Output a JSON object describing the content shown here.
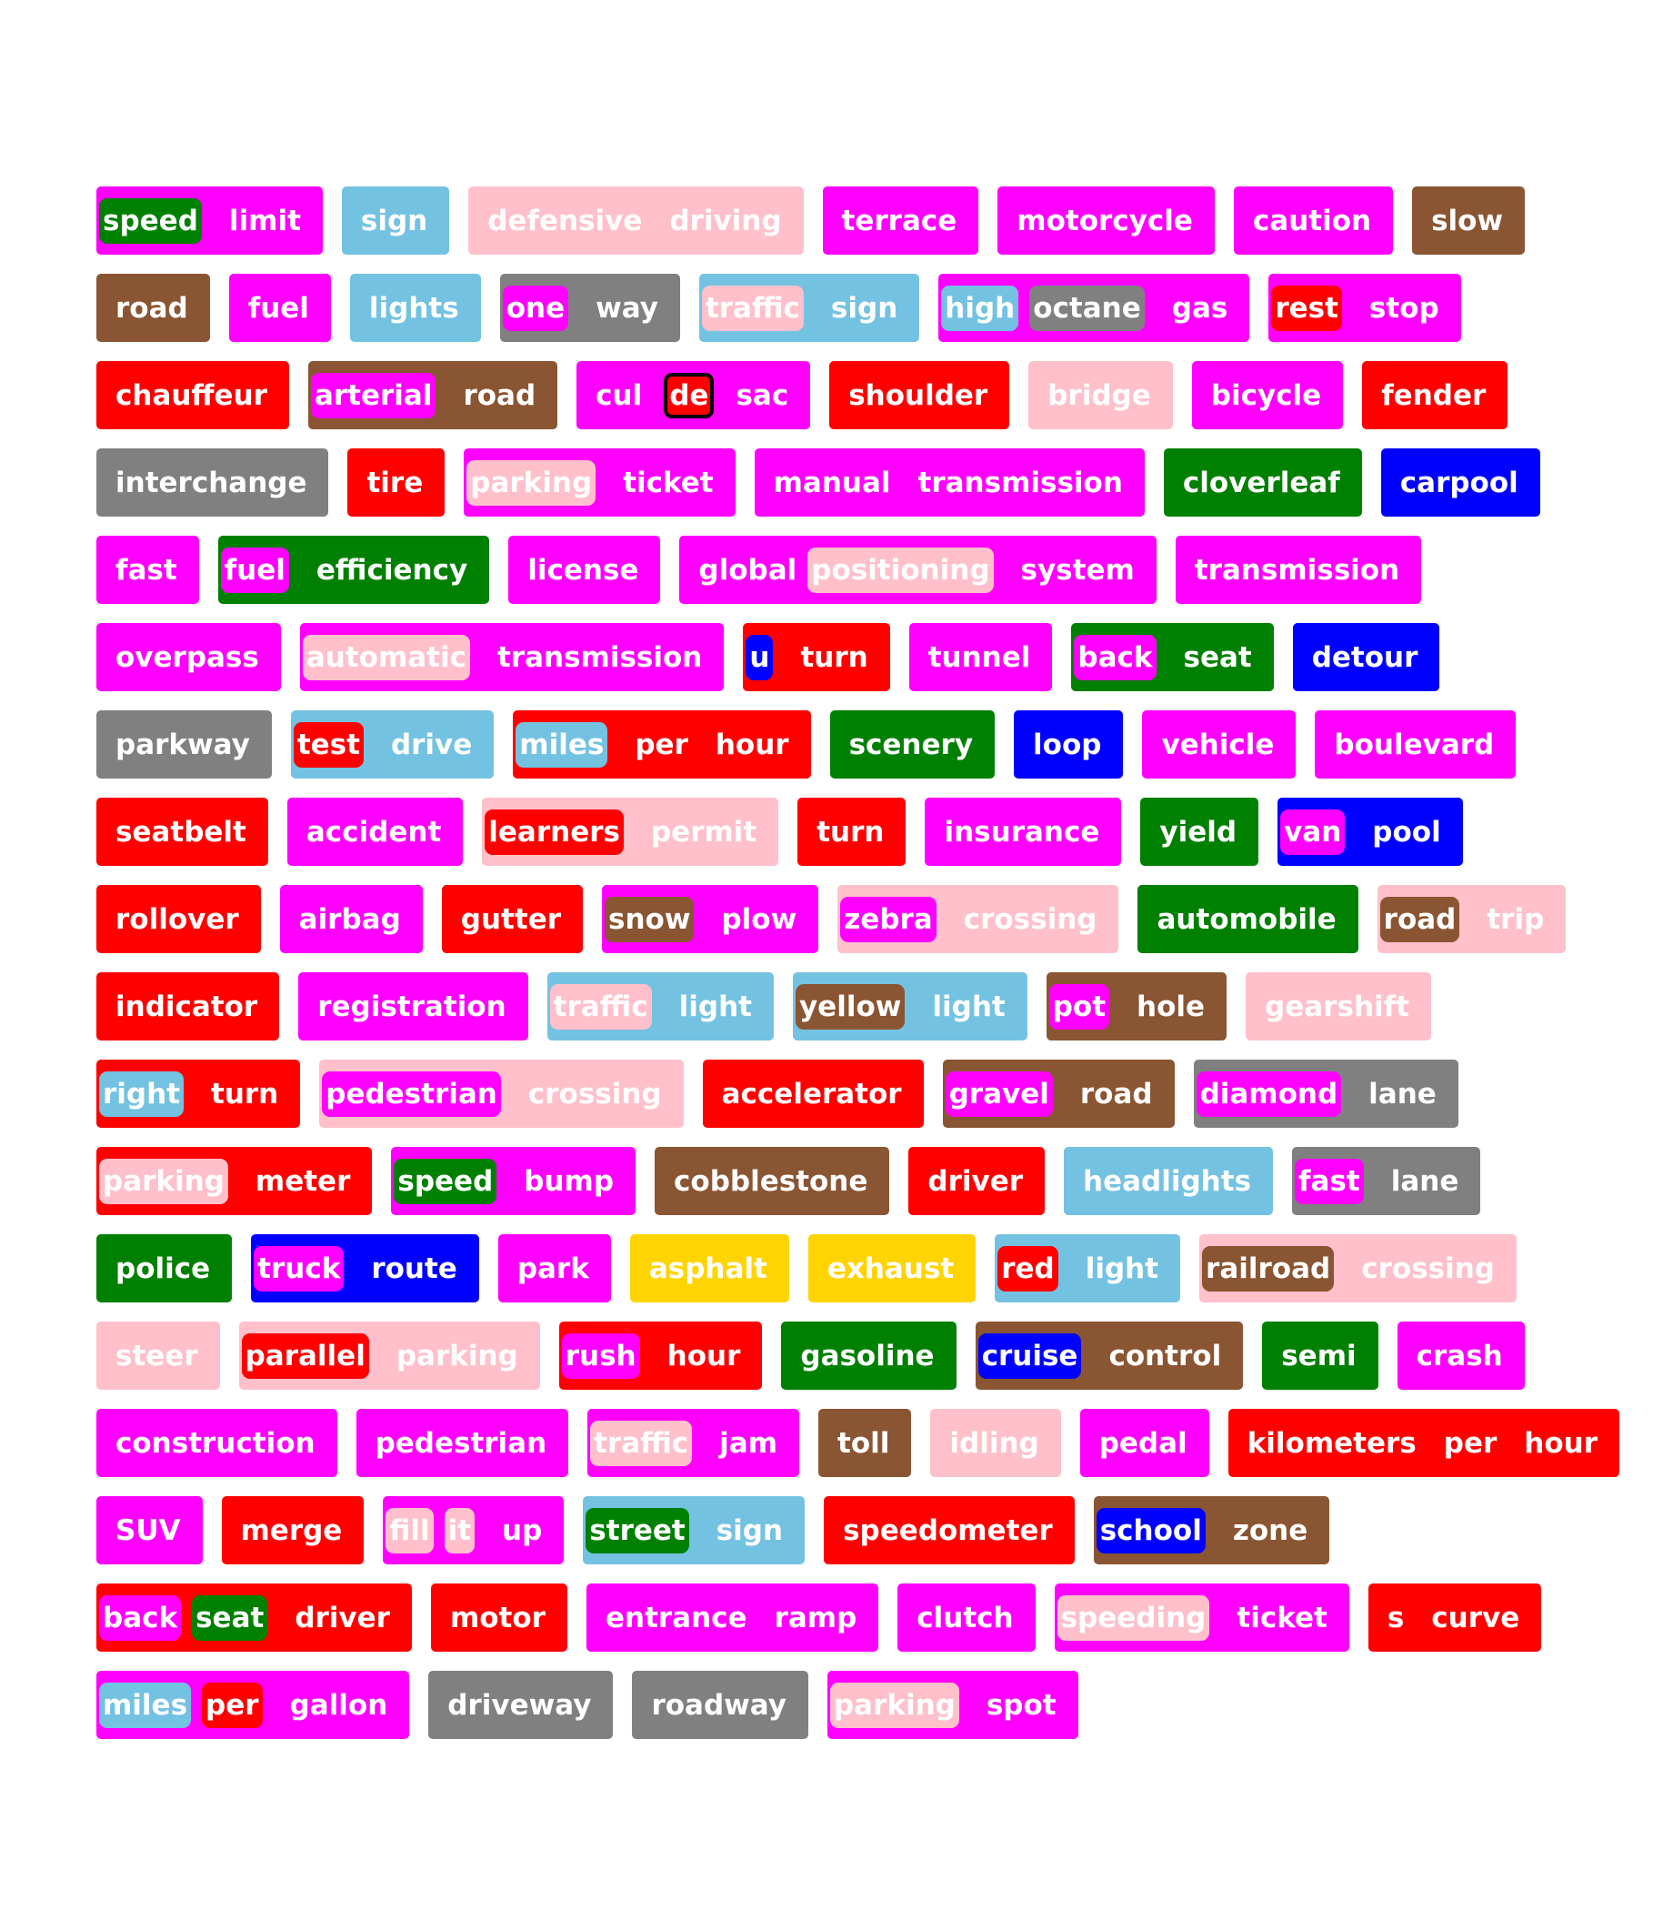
{
  "colors": {
    "magenta": "#ff00ff",
    "blue": "#0000ff",
    "green": "#008000",
    "red": "#ff0000",
    "brown": "#8a5532",
    "grey": "#808080",
    "lightblue": "#74c2e1",
    "pink": "#ffc0cb",
    "yellow": "#ffd400"
  },
  "chips": [
    {
      "bg": "magenta",
      "words": [
        {
          "t": "speed",
          "hl": "green"
        },
        {
          "t": "limit"
        }
      ]
    },
    {
      "bg": "lightblue",
      "words": [
        {
          "t": "sign"
        }
      ]
    },
    {
      "bg": "pink",
      "words": [
        {
          "t": "defensive"
        },
        {
          "t": "driving"
        }
      ]
    },
    {
      "bg": "magenta",
      "words": [
        {
          "t": "terrace"
        }
      ]
    },
    {
      "bg": "magenta",
      "words": [
        {
          "t": "motorcycle"
        }
      ]
    },
    {
      "bg": "magenta",
      "words": [
        {
          "t": "caution"
        }
      ]
    },
    {
      "bg": "brown",
      "words": [
        {
          "t": "slow"
        }
      ]
    },
    {
      "bg": "brown",
      "words": [
        {
          "t": "road"
        }
      ]
    },
    {
      "bg": "magenta",
      "words": [
        {
          "t": "fuel"
        }
      ]
    },
    {
      "bg": "lightblue",
      "words": [
        {
          "t": "lights"
        }
      ]
    },
    {
      "bg": "grey",
      "words": [
        {
          "t": "one",
          "hl": "magenta"
        },
        {
          "t": "way"
        }
      ]
    },
    {
      "bg": "lightblue",
      "words": [
        {
          "t": "traffic",
          "hl": "pink"
        },
        {
          "t": "sign"
        }
      ]
    },
    {
      "bg": "magenta",
      "words": [
        {
          "t": "high",
          "hl": "lightblue"
        },
        {
          "t": "octane",
          "hl": "grey"
        },
        {
          "t": "gas"
        }
      ]
    },
    {
      "bg": "magenta",
      "words": [
        {
          "t": "rest",
          "hl": "red"
        },
        {
          "t": "stop"
        }
      ]
    },
    {
      "bg": "red",
      "words": [
        {
          "t": "chauffeur"
        }
      ]
    },
    {
      "bg": "brown",
      "words": [
        {
          "t": "arterial",
          "hl": "magenta"
        },
        {
          "t": "road"
        }
      ]
    },
    {
      "bg": "magenta",
      "words": [
        {
          "t": "cul"
        },
        {
          "t": "de",
          "box": "red"
        },
        {
          "t": "sac"
        }
      ]
    },
    {
      "bg": "red",
      "words": [
        {
          "t": "shoulder"
        }
      ]
    },
    {
      "bg": "pink",
      "words": [
        {
          "t": "bridge"
        }
      ]
    },
    {
      "bg": "magenta",
      "words": [
        {
          "t": "bicycle"
        }
      ]
    },
    {
      "bg": "red",
      "words": [
        {
          "t": "fender"
        }
      ]
    },
    {
      "bg": "grey",
      "words": [
        {
          "t": "interchange"
        }
      ]
    },
    {
      "bg": "red",
      "words": [
        {
          "t": "tire"
        }
      ]
    },
    {
      "bg": "magenta",
      "words": [
        {
          "t": "parking",
          "hl": "pink"
        },
        {
          "t": "ticket"
        }
      ]
    },
    {
      "bg": "magenta",
      "words": [
        {
          "t": "manual"
        },
        {
          "t": "transmission"
        }
      ]
    },
    {
      "bg": "green",
      "words": [
        {
          "t": "cloverleaf"
        }
      ]
    },
    {
      "bg": "blue",
      "words": [
        {
          "t": "carpool"
        }
      ]
    },
    {
      "bg": "magenta",
      "words": [
        {
          "t": "fast"
        }
      ]
    },
    {
      "bg": "green",
      "words": [
        {
          "t": "fuel",
          "hl": "magenta"
        },
        {
          "t": "efficiency"
        }
      ]
    },
    {
      "bg": "magenta",
      "words": [
        {
          "t": "license"
        }
      ]
    },
    {
      "bg": "magenta",
      "words": [
        {
          "t": "global"
        },
        {
          "t": "positioning",
          "hl": "pink"
        },
        {
          "t": "system"
        }
      ]
    },
    {
      "bg": "magenta",
      "words": [
        {
          "t": "transmission"
        }
      ]
    },
    {
      "bg": "magenta",
      "words": [
        {
          "t": "overpass"
        }
      ]
    },
    {
      "bg": "magenta",
      "words": [
        {
          "t": "automatic",
          "hl": "pink"
        },
        {
          "t": "transmission"
        }
      ]
    },
    {
      "bg": "red",
      "words": [
        {
          "t": "u",
          "hl": "blue"
        },
        {
          "t": "turn"
        }
      ]
    },
    {
      "bg": "magenta",
      "words": [
        {
          "t": "tunnel"
        }
      ]
    },
    {
      "bg": "green",
      "words": [
        {
          "t": "back",
          "hl": "magenta"
        },
        {
          "t": "seat"
        }
      ]
    },
    {
      "bg": "blue",
      "words": [
        {
          "t": "detour"
        }
      ]
    },
    {
      "bg": "grey",
      "words": [
        {
          "t": "parkway"
        }
      ]
    },
    {
      "bg": "lightblue",
      "words": [
        {
          "t": "test",
          "hl": "red"
        },
        {
          "t": "drive"
        }
      ]
    },
    {
      "bg": "red",
      "words": [
        {
          "t": "miles",
          "hl": "lightblue"
        },
        {
          "t": "per"
        },
        {
          "t": "hour"
        }
      ]
    },
    {
      "bg": "green",
      "words": [
        {
          "t": "scenery"
        }
      ]
    },
    {
      "bg": "blue",
      "words": [
        {
          "t": "loop"
        }
      ]
    },
    {
      "bg": "magenta",
      "words": [
        {
          "t": "vehicle"
        }
      ]
    },
    {
      "bg": "magenta",
      "words": [
        {
          "t": "boulevard"
        }
      ]
    },
    {
      "bg": "red",
      "words": [
        {
          "t": "seatbelt"
        }
      ]
    },
    {
      "bg": "magenta",
      "words": [
        {
          "t": "accident"
        }
      ]
    },
    {
      "bg": "pink",
      "words": [
        {
          "t": "learners",
          "hl": "red"
        },
        {
          "t": "permit"
        }
      ]
    },
    {
      "bg": "red",
      "words": [
        {
          "t": "turn"
        }
      ]
    },
    {
      "bg": "magenta",
      "words": [
        {
          "t": "insurance"
        }
      ]
    },
    {
      "bg": "green",
      "words": [
        {
          "t": "yield"
        }
      ]
    },
    {
      "bg": "blue",
      "words": [
        {
          "t": "van",
          "hl": "magenta"
        },
        {
          "t": "pool"
        }
      ]
    },
    {
      "bg": "red",
      "words": [
        {
          "t": "rollover"
        }
      ]
    },
    {
      "bg": "magenta",
      "words": [
        {
          "t": "airbag"
        }
      ]
    },
    {
      "bg": "red",
      "words": [
        {
          "t": "gutter"
        }
      ]
    },
    {
      "bg": "magenta",
      "words": [
        {
          "t": "snow",
          "hl": "brown"
        },
        {
          "t": "plow"
        }
      ]
    },
    {
      "bg": "pink",
      "words": [
        {
          "t": "zebra",
          "hl": "magenta"
        },
        {
          "t": "crossing"
        }
      ]
    },
    {
      "bg": "green",
      "words": [
        {
          "t": "automobile"
        }
      ]
    },
    {
      "bg": "pink",
      "words": [
        {
          "t": "road",
          "hl": "brown"
        },
        {
          "t": "trip"
        }
      ]
    },
    {
      "bg": "red",
      "words": [
        {
          "t": "indicator"
        }
      ]
    },
    {
      "bg": "magenta",
      "words": [
        {
          "t": "registration"
        }
      ]
    },
    {
      "bg": "lightblue",
      "words": [
        {
          "t": "traffic",
          "hl": "pink"
        },
        {
          "t": "light"
        }
      ]
    },
    {
      "bg": "lightblue",
      "words": [
        {
          "t": "yellow",
          "hl": "brown"
        },
        {
          "t": "light"
        }
      ]
    },
    {
      "bg": "brown",
      "words": [
        {
          "t": "pot",
          "hl": "magenta"
        },
        {
          "t": "hole"
        }
      ]
    },
    {
      "bg": "pink",
      "words": [
        {
          "t": "gearshift"
        }
      ]
    },
    {
      "bg": "red",
      "words": [
        {
          "t": "right",
          "hl": "lightblue"
        },
        {
          "t": "turn"
        }
      ]
    },
    {
      "bg": "pink",
      "words": [
        {
          "t": "pedestrian",
          "hl": "magenta"
        },
        {
          "t": "crossing"
        }
      ]
    },
    {
      "bg": "red",
      "words": [
        {
          "t": "accelerator"
        }
      ]
    },
    {
      "bg": "brown",
      "words": [
        {
          "t": "gravel",
          "hl": "magenta"
        },
        {
          "t": "road"
        }
      ]
    },
    {
      "bg": "grey",
      "words": [
        {
          "t": "diamond",
          "hl": "magenta"
        },
        {
          "t": "lane"
        }
      ]
    },
    {
      "bg": "red",
      "words": [
        {
          "t": "parking",
          "hl": "pink"
        },
        {
          "t": "meter"
        }
      ]
    },
    {
      "bg": "magenta",
      "words": [
        {
          "t": "speed",
          "hl": "green"
        },
        {
          "t": "bump"
        }
      ]
    },
    {
      "bg": "brown",
      "words": [
        {
          "t": "cobblestone"
        }
      ]
    },
    {
      "bg": "red",
      "words": [
        {
          "t": "driver"
        }
      ]
    },
    {
      "bg": "lightblue",
      "words": [
        {
          "t": "headlights"
        }
      ]
    },
    {
      "bg": "grey",
      "words": [
        {
          "t": "fast",
          "hl": "magenta"
        },
        {
          "t": "lane"
        }
      ]
    },
    {
      "bg": "green",
      "words": [
        {
          "t": "police"
        }
      ]
    },
    {
      "bg": "blue",
      "words": [
        {
          "t": "truck",
          "hl": "magenta"
        },
        {
          "t": "route"
        }
      ]
    },
    {
      "bg": "magenta",
      "words": [
        {
          "t": "park"
        }
      ]
    },
    {
      "bg": "yellow",
      "words": [
        {
          "t": "asphalt"
        }
      ]
    },
    {
      "bg": "yellow",
      "words": [
        {
          "t": "exhaust"
        }
      ]
    },
    {
      "bg": "lightblue",
      "words": [
        {
          "t": "red",
          "hl": "red"
        },
        {
          "t": "light"
        }
      ]
    },
    {
      "bg": "pink",
      "words": [
        {
          "t": "railroad",
          "hl": "brown"
        },
        {
          "t": "crossing"
        }
      ]
    },
    {
      "bg": "pink",
      "words": [
        {
          "t": "steer"
        }
      ]
    },
    {
      "bg": "pink",
      "words": [
        {
          "t": "parallel",
          "hl": "red"
        },
        {
          "t": "parking"
        }
      ]
    },
    {
      "bg": "red",
      "words": [
        {
          "t": "rush",
          "hl": "magenta"
        },
        {
          "t": "hour"
        }
      ]
    },
    {
      "bg": "green",
      "words": [
        {
          "t": "gasoline"
        }
      ]
    },
    {
      "bg": "brown",
      "words": [
        {
          "t": "cruise",
          "hl": "blue"
        },
        {
          "t": "control"
        }
      ]
    },
    {
      "bg": "green",
      "words": [
        {
          "t": "semi"
        }
      ]
    },
    {
      "bg": "magenta",
      "words": [
        {
          "t": "crash"
        }
      ]
    },
    {
      "bg": "magenta",
      "words": [
        {
          "t": "construction"
        }
      ]
    },
    {
      "bg": "magenta",
      "words": [
        {
          "t": "pedestrian"
        }
      ]
    },
    {
      "bg": "magenta",
      "words": [
        {
          "t": "traffic",
          "hl": "pink"
        },
        {
          "t": "jam"
        }
      ]
    },
    {
      "bg": "brown",
      "words": [
        {
          "t": "toll"
        }
      ]
    },
    {
      "bg": "pink",
      "words": [
        {
          "t": "idling"
        }
      ]
    },
    {
      "bg": "magenta",
      "words": [
        {
          "t": "pedal"
        }
      ]
    },
    {
      "bg": "red",
      "words": [
        {
          "t": "kilometers"
        },
        {
          "t": "per"
        },
        {
          "t": "hour"
        }
      ]
    },
    {
      "bg": "magenta",
      "words": [
        {
          "t": "SUV"
        }
      ]
    },
    {
      "bg": "red",
      "words": [
        {
          "t": "merge"
        }
      ]
    },
    {
      "bg": "magenta",
      "words": [
        {
          "t": "fill",
          "hl": "pink"
        },
        {
          "t": "it",
          "hl": "pink"
        },
        {
          "t": "up"
        }
      ]
    },
    {
      "bg": "lightblue",
      "words": [
        {
          "t": "street",
          "hl": "green"
        },
        {
          "t": "sign"
        }
      ]
    },
    {
      "bg": "red",
      "words": [
        {
          "t": "speedometer"
        }
      ]
    },
    {
      "bg": "brown",
      "words": [
        {
          "t": "school",
          "hl": "blue"
        },
        {
          "t": "zone"
        }
      ]
    },
    {
      "bg": "red",
      "words": [
        {
          "t": "back",
          "hl": "magenta"
        },
        {
          "t": "seat",
          "hl": "green"
        },
        {
          "t": "driver"
        }
      ]
    },
    {
      "bg": "red",
      "words": [
        {
          "t": "motor"
        }
      ]
    },
    {
      "bg": "magenta",
      "words": [
        {
          "t": "entrance"
        },
        {
          "t": "ramp"
        }
      ]
    },
    {
      "bg": "magenta",
      "words": [
        {
          "t": "clutch"
        }
      ]
    },
    {
      "bg": "magenta",
      "words": [
        {
          "t": "speeding",
          "hl": "pink"
        },
        {
          "t": "ticket"
        }
      ]
    },
    {
      "bg": "red",
      "words": [
        {
          "t": "s"
        },
        {
          "t": "curve"
        }
      ]
    },
    {
      "bg": "magenta",
      "words": [
        {
          "t": "miles",
          "hl": "lightblue"
        },
        {
          "t": "per",
          "hl": "red"
        },
        {
          "t": "gallon"
        }
      ]
    },
    {
      "bg": "grey",
      "words": [
        {
          "t": "driveway"
        }
      ]
    },
    {
      "bg": "grey",
      "words": [
        {
          "t": "roadway"
        }
      ]
    },
    {
      "bg": "magenta",
      "words": [
        {
          "t": "parking",
          "hl": "pink"
        },
        {
          "t": "spot"
        }
      ]
    }
  ]
}
